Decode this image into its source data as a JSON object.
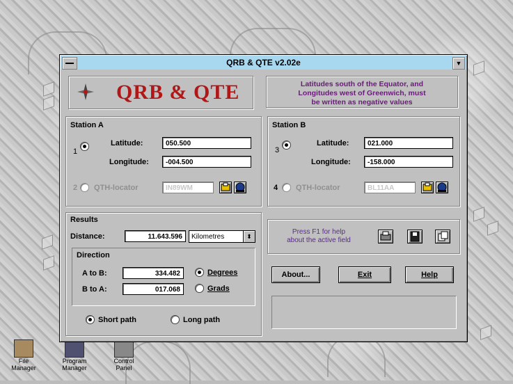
{
  "window": {
    "title": "QRB & QTE v2.02e"
  },
  "logo": {
    "text": "QRB & QTE"
  },
  "notice": {
    "line1": "Latitudes south of the Equator, and",
    "line2": "Longitudes west of Greenwich, must",
    "line3": "be written as negative values"
  },
  "station_a": {
    "heading": "Station A",
    "latitude_label": "Latitude:",
    "latitude_value": "050.500",
    "longitude_label": "Longitude:",
    "longitude_value": "-004.500",
    "radio1_label": "1",
    "radio2_label": "2",
    "qth_label": "QTH-locator",
    "qth_value": "IN89WM"
  },
  "station_b": {
    "heading": "Station B",
    "latitude_label": "Latitude:",
    "latitude_value": "021.000",
    "longitude_label": "Longitude:",
    "longitude_value": "-158.000",
    "radio3_label": "3",
    "radio4_label": "4",
    "qth_label": "QTH-locator",
    "qth_value": "BL11AA"
  },
  "results": {
    "heading": "Results",
    "distance_label": "Distance:",
    "distance_value": "11.643.596",
    "unit_selected": "Kilometres",
    "direction_heading": "Direction",
    "a_to_b_label": "A to B:",
    "a_to_b_value": "334.482",
    "b_to_a_label": "B to A:",
    "b_to_a_value": "017.068",
    "degrees_label": "Degrees",
    "grads_label": "Grads",
    "short_path_label": "Short path",
    "long_path_label": "Long path"
  },
  "help_panel": {
    "hint_line1": "Press F1 for help",
    "hint_line2": "about the active field"
  },
  "buttons": {
    "about": "About...",
    "exit": "Exit",
    "help": "Help"
  },
  "taskbar": [
    {
      "label": "File Manager",
      "icon": "file-manager-icon"
    },
    {
      "label": "Program Manager",
      "icon": "program-manager-icon"
    },
    {
      "label": "Control Panel",
      "icon": "control-panel-icon"
    }
  ]
}
